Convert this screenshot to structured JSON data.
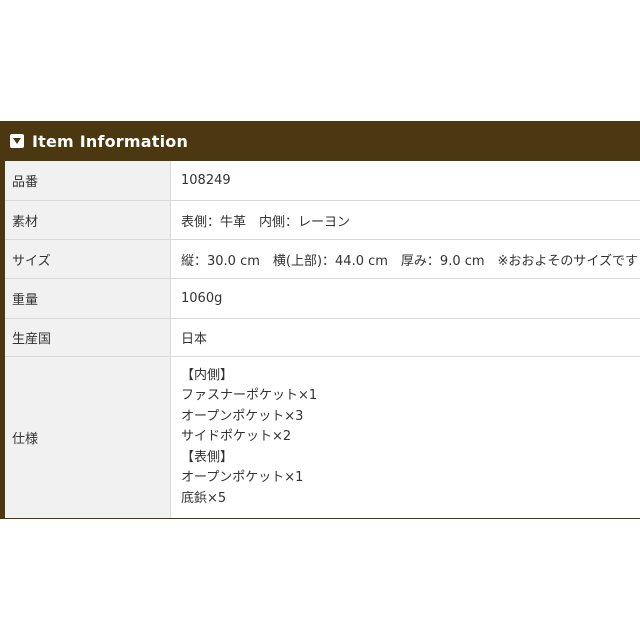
{
  "header": {
    "title": "Item Information",
    "icon": "dropdown-triangle-icon"
  },
  "spec_rows": [
    {
      "label": "品番",
      "value": "108249"
    },
    {
      "label": "素材",
      "value": "表側：牛革　内側：レーヨン"
    },
    {
      "label": "サイズ",
      "value": "縦：30.0 cm　横(上部)：44.0 cm　厚み：9.0 cm　※おおよそのサイズです"
    },
    {
      "label": "重量",
      "value": "1060g"
    },
    {
      "label": "生産国",
      "value": "日本"
    },
    {
      "label": "仕様",
      "lines": [
        "【内側】",
        "ファスナーポケット×1",
        "オープンポケット×3",
        "サイドポケット×2",
        "【表側】",
        "オープンポケット×1",
        "底鋲×5"
      ]
    }
  ],
  "colors": {
    "header_bg": "#4c3810",
    "label_bg": "#f1f1f1",
    "border": "#d9d9d9",
    "text": "#333333"
  }
}
